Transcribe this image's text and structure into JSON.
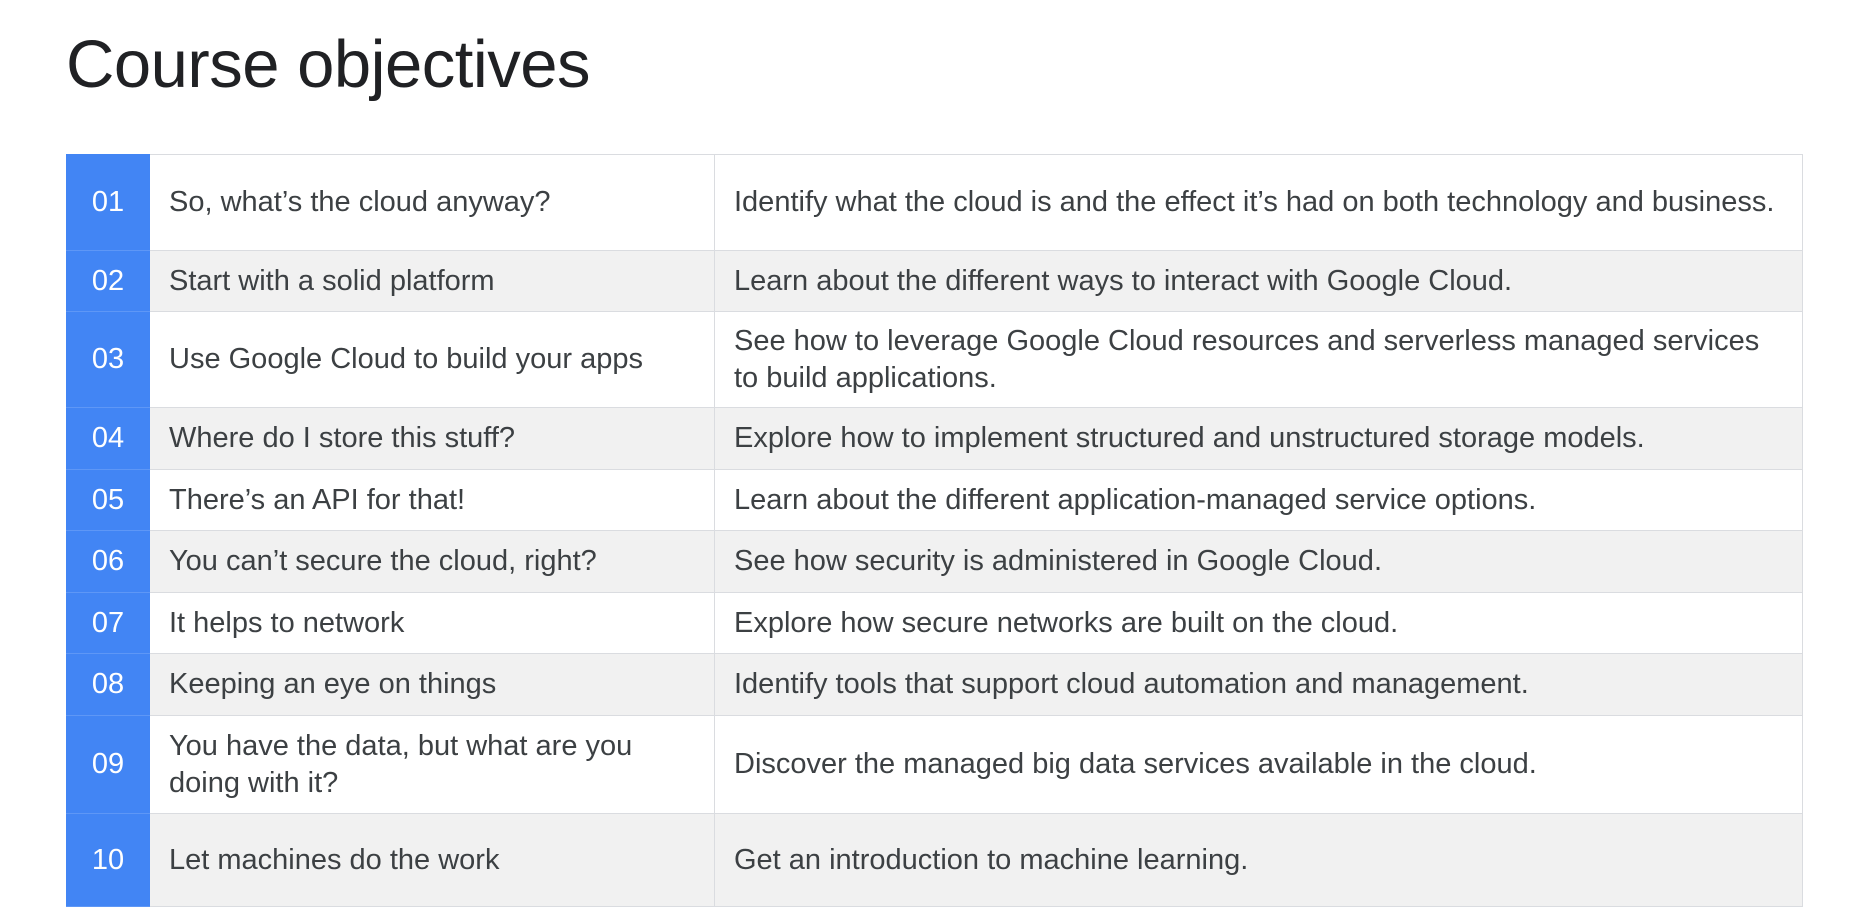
{
  "title": "Course objectives",
  "accent_color": "#4285f4",
  "objectives": [
    {
      "number": "01",
      "topic": "So, what’s the cloud anyway?",
      "description": "Identify what the cloud is and the effect it’s had on both technology and business."
    },
    {
      "number": "02",
      "topic": "Start with a solid platform",
      "description": "Learn about the different ways to interact with Google Cloud."
    },
    {
      "number": "03",
      "topic": "Use Google Cloud to build your apps",
      "description": "See how to leverage Google Cloud resources and serverless managed services to build applications."
    },
    {
      "number": "04",
      "topic": "Where do I store this stuff?",
      "description": "Explore how to implement structured and unstructured storage models."
    },
    {
      "number": "05",
      "topic": "There’s an API for that!",
      "description": "Learn about the different application-managed service options."
    },
    {
      "number": "06",
      "topic": "You can’t secure the cloud, right?",
      "description": "See how security is administered in Google Cloud."
    },
    {
      "number": "07",
      "topic": "It helps to network",
      "description": "Explore how secure networks are built on the cloud."
    },
    {
      "number": "08",
      "topic": "Keeping an eye on things",
      "description": "Identify tools that support cloud automation and management."
    },
    {
      "number": "09",
      "topic": "You have the data, but what are you doing with it?",
      "description": "Discover the managed big data services available in the cloud."
    },
    {
      "number": "10",
      "topic": "Let machines do the work",
      "description": "Get an introduction to machine learning."
    }
  ]
}
